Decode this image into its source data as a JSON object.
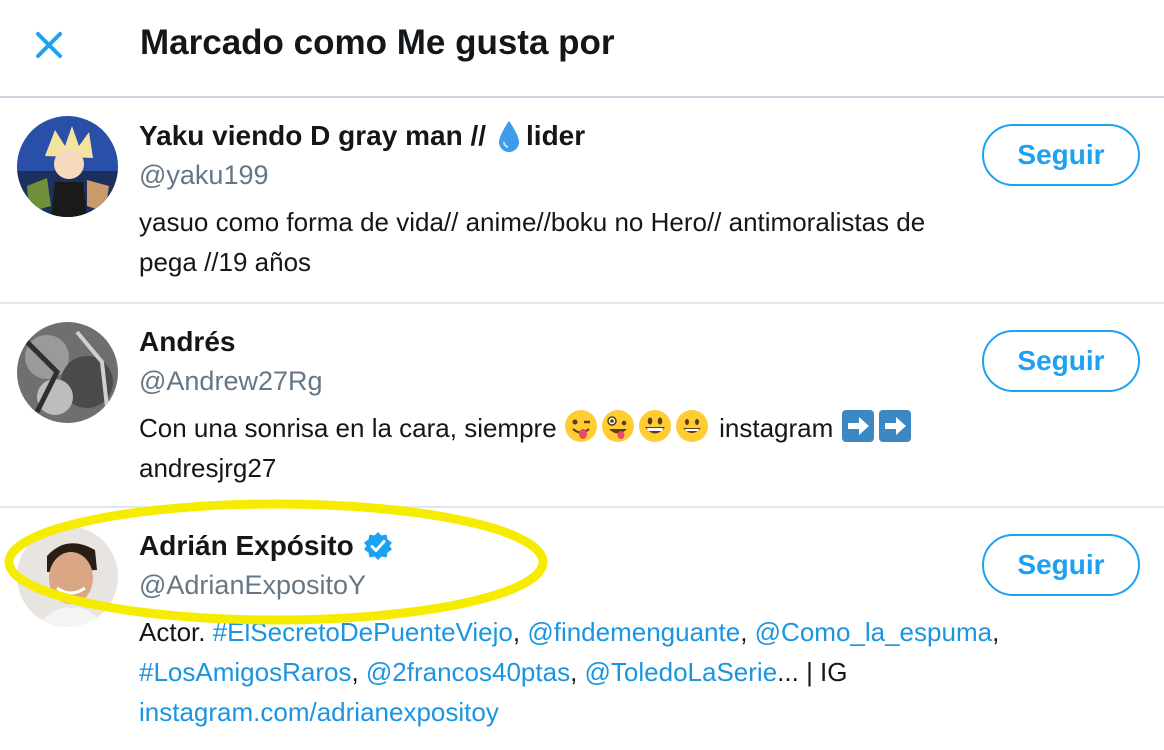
{
  "header": {
    "title": "Marcado como Me gusta por",
    "close_icon": "close-icon"
  },
  "users": [
    {
      "name_before": "Yaku viendo D gray man // ",
      "name_after": "lider",
      "name_icon": "droplet-icon",
      "handle": "@yaku199",
      "bio_line1": "yasuo como forma de vida// anime//boku no Hero// antimoralistas de",
      "bio_line2": "pega //19 años",
      "follow_label": "Seguir"
    },
    {
      "name": "Andrés",
      "handle": "@Andrew27Rg",
      "bio_text1": "Con una sonrisa en la cara, siempre ",
      "bio_text2": " instagram ",
      "bio_line2": "andresjrg27",
      "emojis": [
        "winking-tongue-emoji",
        "zany-face-emoji",
        "grinning-emoji",
        "grinning-face-emoji"
      ],
      "arrows": [
        "right-arrow-emoji",
        "right-arrow-emoji"
      ],
      "follow_label": "Seguir"
    },
    {
      "name": "Adrián Expósito",
      "verified_icon": "verified-badge-icon",
      "handle": "@AdrianExpositoY",
      "bio_prefix": "Actor. ",
      "links_line1": [
        "#ElSecretoDePuenteViejo",
        "@findemenguante",
        "@Como_la_espuma"
      ],
      "links_line2": [
        "#LosAmigosRaros",
        "@2francos40ptas",
        "@ToledoLaSerie"
      ],
      "bio_suffix": "... | IG",
      "link_line3": "instagram.com/adrianexpositoy",
      "follow_label": "Seguir"
    }
  ],
  "colors": {
    "accent": "#1da1f2",
    "link": "#1b95e0",
    "muted": "#657786",
    "highlight": "#f5ec00"
  }
}
